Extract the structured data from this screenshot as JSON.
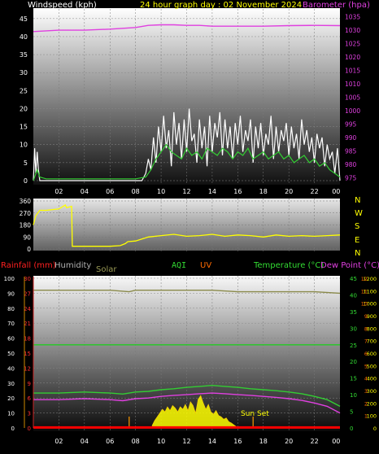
{
  "header": {
    "windspeed_label": "Windspeed (kph)",
    "title": "24 hour graph day : 02 November 2024",
    "barometer_label": "Barometer (hpa)"
  },
  "legend3": {
    "rainfall": "Rainfall (mm)",
    "humidity": "Humidity",
    "solar": "Solar",
    "aqi": "AQI",
    "uv": "UV",
    "temperature": "Temperature (°C)",
    "dewpoint": "Dew Point (°C)"
  },
  "annotations": {
    "sunset": "Sun Set"
  },
  "compass": [
    "N",
    "W",
    "S",
    "E",
    "N"
  ],
  "colors": {
    "wind_gust": "#ffffff",
    "wind_avg": "#33cc33",
    "barometer": "#e040e0",
    "direction": "#ffff00",
    "temperature": "#33cc33",
    "dewpoint": "#e040e0",
    "humidity": "#8a8a4a",
    "aqi_line": "#22cc22",
    "solar": "#ffff00",
    "rain": "#ff0000"
  },
  "chart_data": [
    {
      "type": "line",
      "xlim": [
        0,
        24
      ],
      "x_ticks": [
        "02",
        "04",
        "06",
        "08",
        "10",
        "12",
        "14",
        "16",
        "18",
        "20",
        "22",
        "00"
      ],
      "y_left_ticks": [
        "0",
        "5",
        "10",
        "15",
        "20",
        "25",
        "30",
        "35",
        "40",
        "45"
      ],
      "ylim_left": [
        0,
        47
      ],
      "y_right_ticks": [
        "975",
        "980",
        "985",
        "990",
        "995",
        "1000",
        "1005",
        "1010",
        "1015",
        "1020",
        "1025",
        "1030",
        "1035"
      ],
      "ylim_right": [
        974,
        1037
      ],
      "series": [
        {
          "name": "Windspeed (kph)",
          "axis": "left",
          "color": "#ffffff",
          "x": [
            0,
            0.1,
            0.2,
            0.3,
            0.4,
            0.5,
            1,
            2,
            3,
            4,
            5,
            6,
            7,
            8,
            8.5,
            8.8,
            9.0,
            9.2,
            9.4,
            9.6,
            9.8,
            10.0,
            10.2,
            10.4,
            10.6,
            10.8,
            11.0,
            11.2,
            11.4,
            11.6,
            11.8,
            12.0,
            12.2,
            12.4,
            12.6,
            12.8,
            13.0,
            13.2,
            13.4,
            13.6,
            13.8,
            14.0,
            14.2,
            14.4,
            14.6,
            14.8,
            15.0,
            15.2,
            15.4,
            15.6,
            15.8,
            16.0,
            16.2,
            16.4,
            16.6,
            16.8,
            17.0,
            17.2,
            17.4,
            17.6,
            17.8,
            18.0,
            18.2,
            18.4,
            18.6,
            18.8,
            19.0,
            19.2,
            19.4,
            19.6,
            19.8,
            20.0,
            20.2,
            20.4,
            20.6,
            20.8,
            21.0,
            21.2,
            21.4,
            21.6,
            21.8,
            22.0,
            22.2,
            22.4,
            22.6,
            22.8,
            23.0,
            23.2,
            23.4,
            23.6,
            23.8,
            24.0
          ],
          "values": [
            0,
            9,
            2,
            8,
            3,
            0,
            0,
            0,
            0,
            0,
            0,
            0,
            0,
            0,
            0,
            2,
            6,
            3,
            12,
            5,
            15,
            8,
            18,
            9,
            14,
            4,
            19,
            10,
            16,
            6,
            17,
            8,
            20,
            11,
            13,
            5,
            17,
            9,
            15,
            4,
            18,
            8,
            16,
            12,
            19,
            7,
            17,
            9,
            15,
            6,
            16,
            10,
            18,
            8,
            14,
            11,
            17,
            5,
            15,
            9,
            16,
            7,
            13,
            10,
            18,
            6,
            15,
            8,
            14,
            11,
            16,
            7,
            15,
            9,
            13,
            6,
            17,
            10,
            14,
            8,
            12,
            5,
            13,
            9,
            12,
            4,
            10,
            6,
            8,
            2,
            9,
            0
          ]
        },
        {
          "name": "Average Windspeed",
          "axis": "left",
          "color": "#33cc33",
          "x": [
            0,
            0.3,
            0.5,
            1,
            4,
            8,
            8.8,
            9.2,
            9.6,
            10.0,
            10.4,
            10.8,
            11.2,
            11.6,
            12.0,
            12.4,
            12.8,
            13.2,
            13.6,
            14.0,
            14.4,
            14.8,
            15.2,
            15.6,
            16.0,
            16.4,
            16.8,
            17.2,
            17.6,
            18.0,
            18.4,
            18.8,
            19.2,
            19.6,
            20.0,
            20.4,
            20.8,
            21.2,
            21.6,
            22.0,
            22.4,
            22.8,
            23.2,
            23.6,
            24.0
          ],
          "values": [
            0,
            3,
            1,
            0.5,
            0.5,
            0.5,
            1,
            3,
            6,
            8,
            10,
            8,
            7,
            6,
            9,
            7,
            8,
            6,
            9,
            8,
            7,
            9,
            8,
            6,
            8,
            7,
            9,
            6,
            7,
            8,
            6,
            7,
            8,
            6,
            7,
            5,
            6,
            7,
            5,
            6,
            4,
            5,
            3,
            2,
            1
          ]
        },
        {
          "name": "Barometer (hpa)",
          "axis": "right",
          "color": "#e040e0",
          "x": [
            0,
            2,
            4,
            6,
            8,
            9,
            10,
            11,
            12,
            13,
            14,
            16,
            18,
            20,
            22,
            24
          ],
          "values": [
            1029.5,
            1030,
            1030,
            1030.4,
            1031,
            1031.8,
            1032,
            1032,
            1031.8,
            1031.8,
            1031.5,
            1031.5,
            1031.5,
            1031.7,
            1031.8,
            1031.7
          ]
        }
      ]
    },
    {
      "type": "line",
      "xlim": [
        0,
        24
      ],
      "y_ticks": [
        "0",
        "90",
        "180",
        "270",
        "360"
      ],
      "ylim": [
        0,
        360
      ],
      "series": [
        {
          "name": "Wind Direction",
          "color": "#ffff00",
          "x": [
            0,
            0.2,
            0.5,
            1,
            2,
            2.5,
            2.6,
            3,
            3.05,
            3.3,
            4,
            5,
            6,
            6.8,
            7.2,
            7.4,
            8,
            8.5,
            9,
            10,
            11,
            12,
            13,
            14,
            15,
            16,
            17,
            18,
            19,
            20,
            21,
            22,
            23,
            24
          ],
          "values": [
            180,
            250,
            290,
            290,
            300,
            330,
            310,
            320,
            20,
            20,
            20,
            20,
            20,
            25,
            40,
            55,
            60,
            75,
            90,
            100,
            110,
            95,
            100,
            110,
            95,
            105,
            100,
            90,
            105,
            95,
            100,
            95,
            100,
            105
          ]
        }
      ]
    },
    {
      "type": "line",
      "xlim": [
        0,
        24
      ],
      "y_ticks_humidity": [
        "0",
        "10",
        "20",
        "30",
        "40",
        "50",
        "60",
        "70",
        "80",
        "90",
        "100"
      ],
      "y_ticks_rain": [
        "0",
        "3",
        "6",
        "9",
        "12",
        "15",
        "18",
        "21",
        "24",
        "27",
        "30"
      ],
      "y_ticks_temp": [
        "0",
        "5",
        "10",
        "15",
        "20",
        "25",
        "30",
        "35",
        "40",
        "45"
      ],
      "y_ticks_solar": [
        "0",
        "100",
        "200",
        "300",
        "400",
        "500",
        "600",
        "700",
        "800",
        "900",
        "1000",
        "1100",
        "1200"
      ],
      "y_ticks_uv": [
        "1",
        "2",
        "3",
        "4",
        "5",
        "6",
        "7",
        "8",
        "9",
        "10",
        "11",
        "12"
      ],
      "series": [
        {
          "name": "Humidity",
          "color": "#8a8a4a",
          "x": [
            0,
            2,
            4,
            6,
            7.5,
            8,
            10,
            12,
            14,
            16,
            18,
            20,
            22,
            24
          ],
          "values": [
            92,
            92,
            92,
            92,
            91,
            92,
            92,
            92,
            92,
            91,
            91,
            91,
            91,
            90
          ]
        },
        {
          "name": "Temperature (°C)",
          "color": "#33cc33",
          "x": [
            0,
            2,
            4,
            6,
            7,
            8,
            9,
            10,
            11,
            12,
            13,
            14,
            15,
            16,
            17,
            18,
            19,
            20,
            21,
            22,
            23,
            24
          ],
          "values": [
            10.5,
            10.5,
            10.8,
            10.5,
            10.2,
            10.8,
            11,
            11.5,
            11.8,
            12.2,
            12.5,
            12.8,
            12.5,
            12.2,
            11.8,
            11.5,
            11.2,
            10.8,
            10.3,
            9.5,
            8.5,
            6.5
          ]
        },
        {
          "name": "Dew Point (°C)",
          "color": "#e040e0",
          "x": [
            0,
            2,
            4,
            6,
            7,
            8,
            9,
            10,
            11,
            12,
            13,
            14,
            15,
            16,
            17,
            18,
            19,
            20,
            21,
            22,
            23,
            24
          ],
          "values": [
            8.5,
            8.5,
            8.8,
            8.5,
            8.2,
            8.8,
            9,
            9.5,
            9.8,
            10,
            10.3,
            10.5,
            10.3,
            10,
            9.8,
            9.5,
            9.2,
            8.8,
            8.3,
            7.5,
            6.5,
            4.5
          ]
        },
        {
          "name": "AQI",
          "color": "#22cc22",
          "x": [
            0,
            24
          ],
          "values": [
            25,
            25
          ]
        },
        {
          "name": "Solar",
          "type": "area",
          "color": "#ffff00",
          "x": [
            9.3,
            9.5,
            9.7,
            9.9,
            10.1,
            10.3,
            10.5,
            10.7,
            10.9,
            11.1,
            11.3,
            11.5,
            11.7,
            11.9,
            12.1,
            12.3,
            12.5,
            12.7,
            12.9,
            13.1,
            13.3,
            13.5,
            13.7,
            13.9,
            14.1,
            14.3,
            14.5,
            14.7,
            14.9,
            15.1,
            15.3,
            15.5,
            15.7,
            15.9,
            16.0
          ],
          "values": [
            20,
            60,
            90,
            120,
            150,
            130,
            170,
            140,
            180,
            160,
            130,
            170,
            150,
            190,
            140,
            210,
            180,
            120,
            230,
            260,
            200,
            150,
            190,
            130,
            110,
            140,
            100,
            90,
            70,
            80,
            50,
            40,
            25,
            10,
            0
          ]
        },
        {
          "name": "Rainfall (mm)",
          "color": "#ff0000",
          "x": [
            0,
            24
          ],
          "values": [
            0.3,
            0.3
          ]
        }
      ],
      "markers_x": [
        7.5,
        17.2
      ]
    }
  ]
}
